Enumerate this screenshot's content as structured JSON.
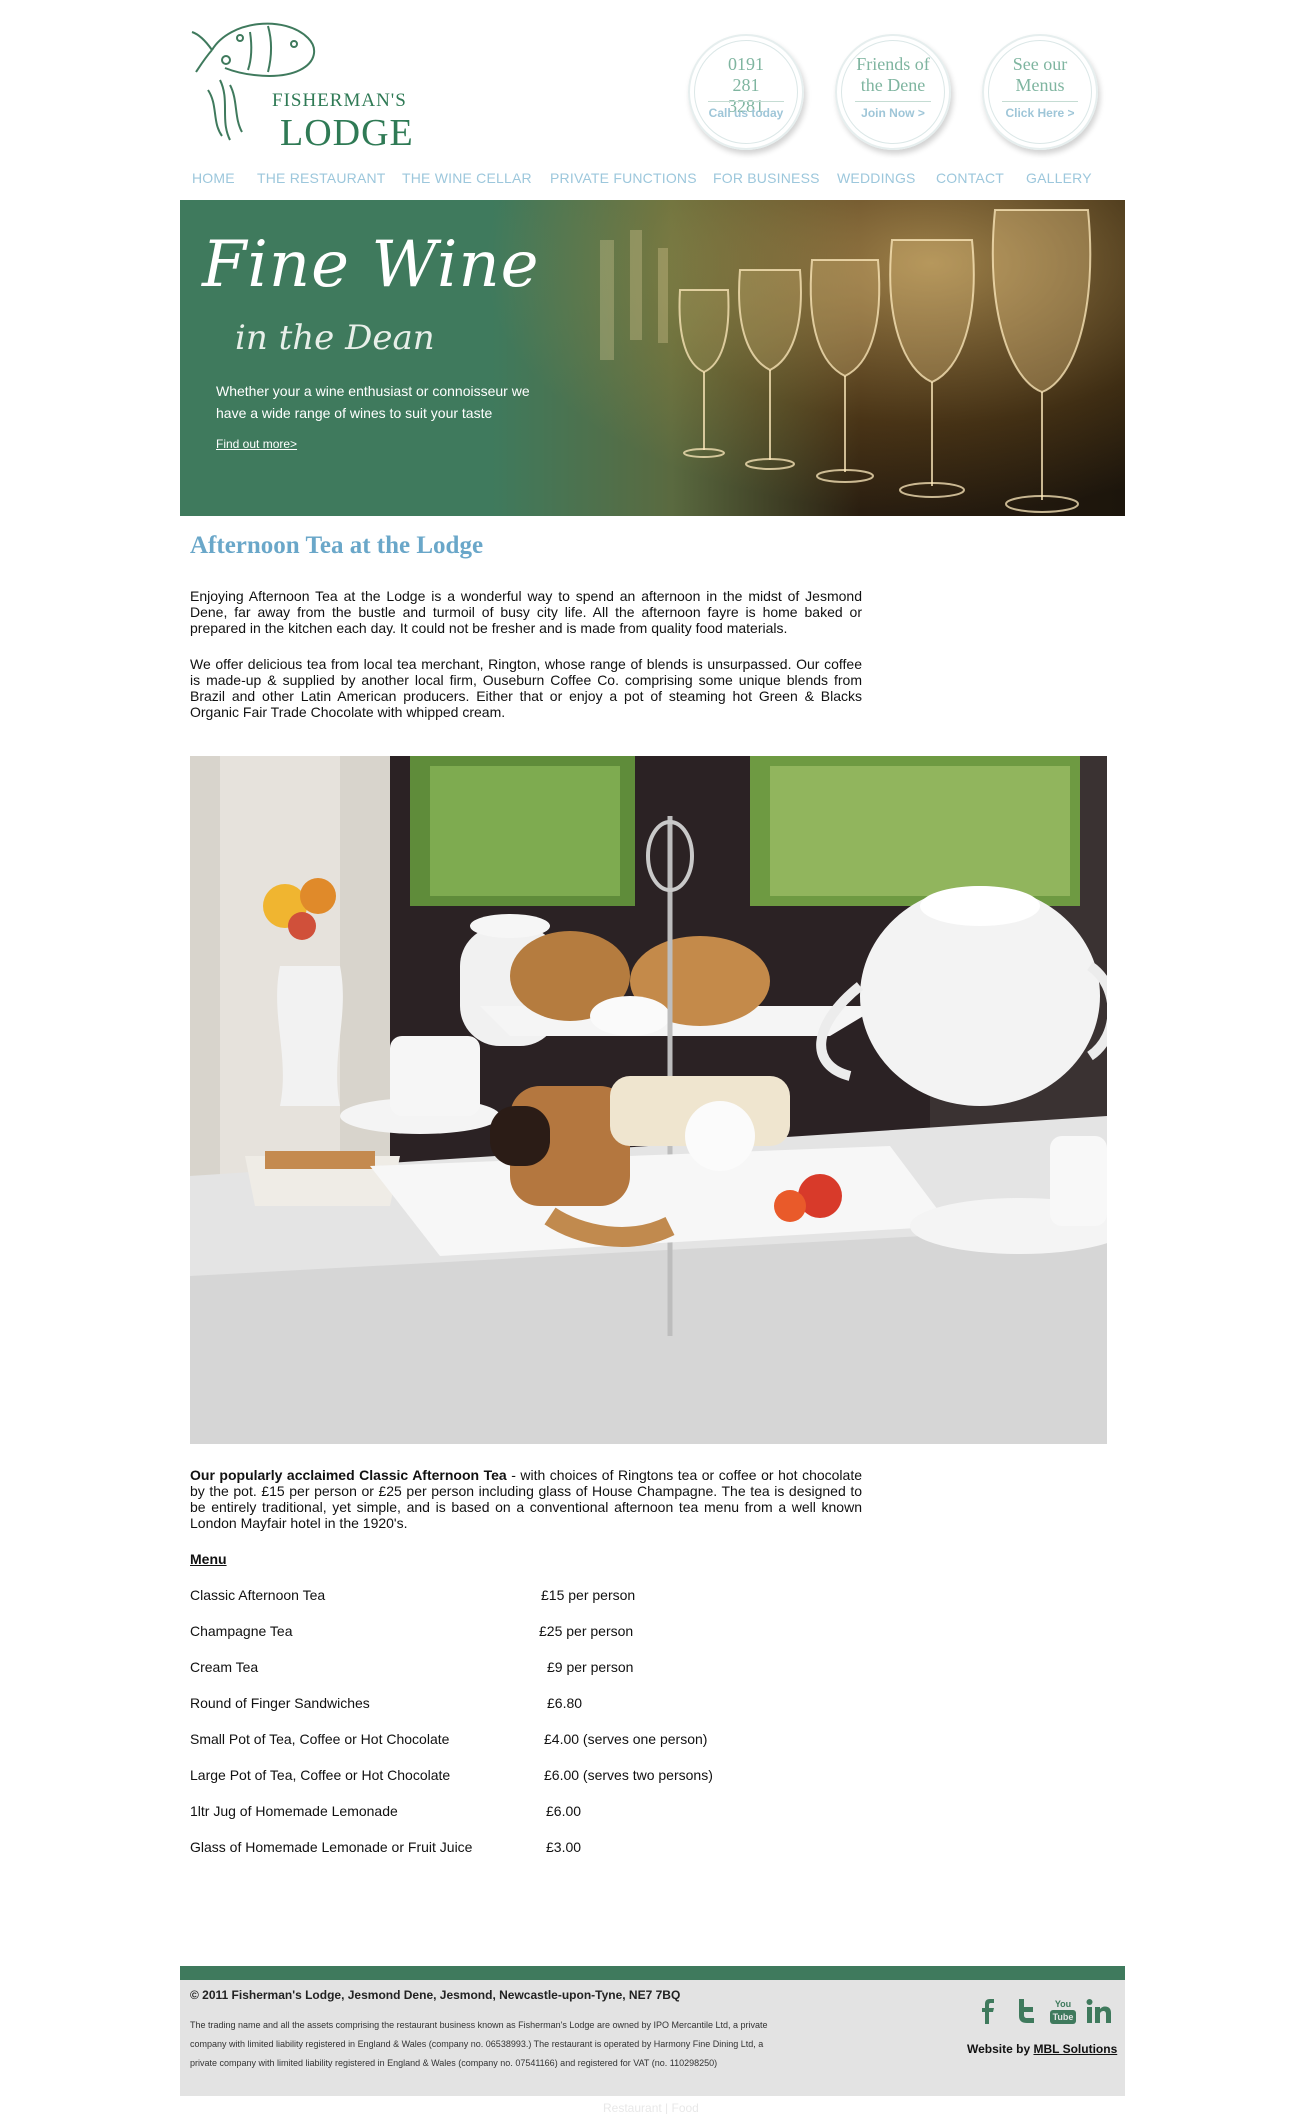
{
  "brand": {
    "line1": "FISHERMAN'S",
    "line2": "LODGE",
    "accent": "#3f7a5d"
  },
  "header_circles": [
    {
      "big": "0191 281 3281",
      "small": "Call us today"
    },
    {
      "big": "Friends of the Dene",
      "small": "Join Now >"
    },
    {
      "big": "See our Menus",
      "small": "Click Here >"
    }
  ],
  "nav": {
    "home": "HOME",
    "restaurant": "THE RESTAURANT",
    "wine": "THE WINE CELLAR",
    "functions": "PRIVATE FUNCTIONS",
    "business": "FOR BUSINESS",
    "weddings": "WEDDINGS",
    "contact": "CONTACT",
    "gallery": "GALLERY"
  },
  "banner": {
    "headline": "Fine Wine",
    "sub": "in the Dean",
    "description": "Whether your a wine enthusiast or connoisseur we have a wide range of wines to suit your taste",
    "link": "Find out more>"
  },
  "page": {
    "title": "Afternoon Tea at the Lodge",
    "para1": "Enjoying Afternoon Tea at the Lodge is a wonderful way to spend an afternoon in the midst of Jesmond Dene, far away from the bustle and turmoil of busy city life.  All the afternoon fayre is home baked or prepared in the kitchen each day.  It could not be fresher and is made from quality food materials.",
    "para2": "We offer delicious tea from local tea merchant, Rington, whose range of blends is unsurpassed.  Our coffee is made-up & supplied by another local firm, Ouseburn Coffee Co. comprising some unique blends from Brazil and other Latin American producers.  Either that or enjoy a pot of steaming hot Green & Blacks Organic Fair Trade Chocolate with whipped cream.",
    "classic_bold": "Our popularly acclaimed Classic Afternoon Tea",
    "classic_rest": " - with choices of Ringtons tea or coffee or hot chocolate by the pot.  £15 per person or £25 per person including glass of House Champagne.  The tea is designed to be entirely traditional, yet simple, and is based on a conventional afternoon tea menu from a well known London Mayfair hotel in the 1920's.",
    "menu_heading": "Menu"
  },
  "menu": [
    {
      "name": "Classic Afternoon Tea",
      "price": "£15 per person"
    },
    {
      "name": "Champagne Tea",
      "price": "£25 per person"
    },
    {
      "name": "Cream Tea",
      "price": "£9 per person"
    },
    {
      "name": "Round of Finger Sandwiches",
      "price": "£6.80"
    },
    {
      "name": "Small Pot of Tea, Coffee or Hot Chocolate",
      "price": "£4.00 (serves one person)"
    },
    {
      "name": "Large Pot of Tea, Coffee or Hot Chocolate",
      "price": "£6.00 (serves two persons)"
    },
    {
      "name": "1ltr Jug of Homemade Lemonade",
      "price": "£6.00"
    },
    {
      "name": "Glass of Homemade Lemonade or Fruit Juice",
      "price": "£3.00"
    }
  ],
  "footer": {
    "copyright": "© 2011 Fisherman's Lodge, Jesmond Dene, Jesmond, Newcastle-upon-Tyne, NE7 7BQ",
    "legal": "The trading name and all the assets comprising the restaurant business known as Fisherman's Lodge are owned by IPO Mercantile Ltd, a private company with limited liability registered in England & Wales (company no. 06538993.) The restaurant is operated by Harmony Fine Dining Ltd, a private company with limited liability registered in England & Wales (company no. 07541166) and registered for VAT (no. 110298250)",
    "website_by": "Website by ",
    "website_link": "MBL Solutions",
    "social": [
      "facebook-icon",
      "twitter-icon",
      "youtube-icon",
      "linkedin-icon"
    ],
    "youtube_label": "You Tube",
    "bottom_links": "Restaurant | Food"
  }
}
